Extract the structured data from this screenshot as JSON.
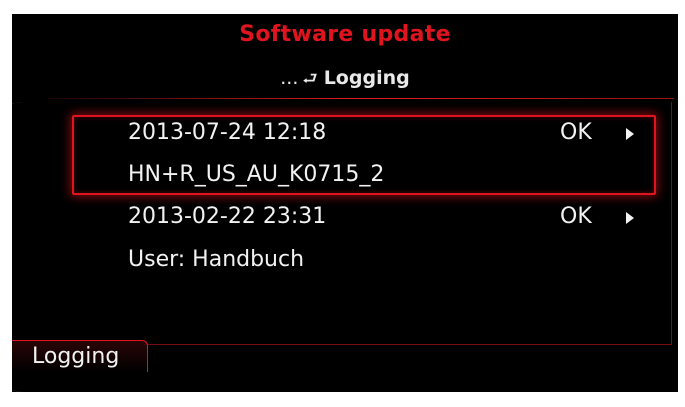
{
  "header": {
    "title": "Software update",
    "breadcrumb_prefix": "...",
    "back_icon": "return-arrow-icon",
    "breadcrumb_current": "Logging"
  },
  "log_entries": [
    {
      "timestamp": "2013-07-24 12:18",
      "status": "OK",
      "detail": "HN+R_US_AU_K0715_2",
      "selected": true
    },
    {
      "timestamp": "2013-02-22 23:31",
      "status": "OK",
      "detail": "User: Handbuch",
      "selected": false
    }
  ],
  "footer": {
    "tab_label": "Logging"
  },
  "colors": {
    "accent": "#e0141e",
    "text": "#f2f2f2",
    "background": "#000000"
  }
}
